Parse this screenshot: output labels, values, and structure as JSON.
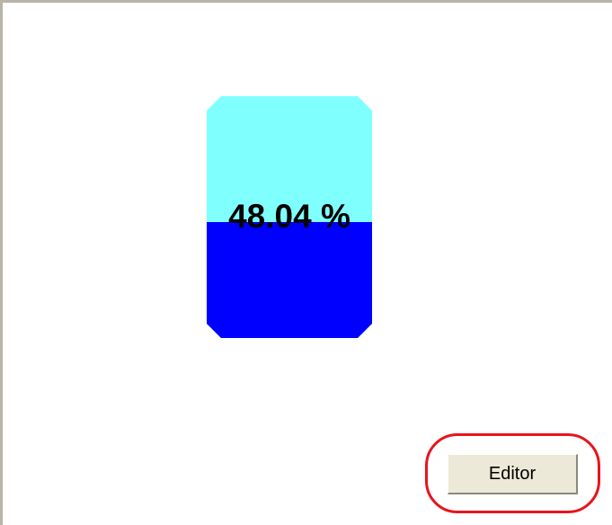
{
  "tank": {
    "level_label": "48.04 %",
    "level_percent": 48.04,
    "empty_color": "#80ffff",
    "fill_color": "#0000ff"
  },
  "editor_button": {
    "label": "Editor"
  },
  "annotation": {
    "ring_color": "#e8141c"
  }
}
